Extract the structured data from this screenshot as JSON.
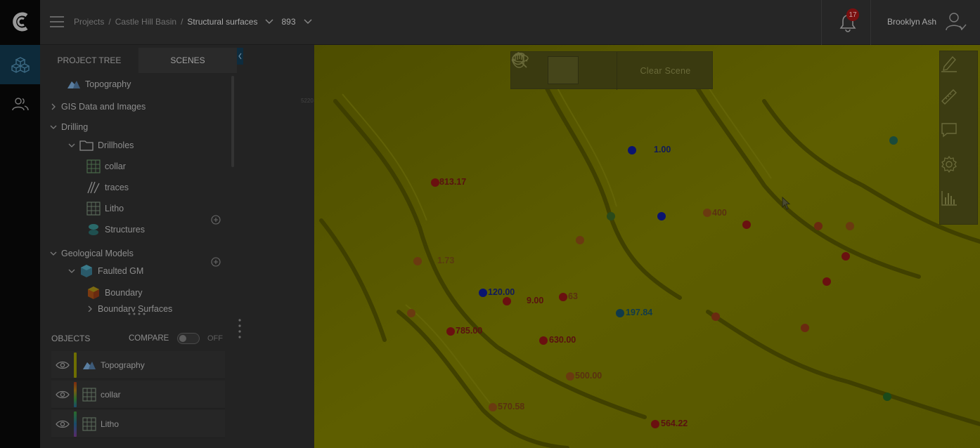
{
  "header": {
    "breadcrumb": {
      "projects": "Projects",
      "sep1": "/",
      "project": "Castle Hill Basin",
      "sep2": "/",
      "current": "Structural surfaces",
      "version": "893"
    },
    "notifications_count": "17",
    "user_name": "Brooklyn Ash"
  },
  "panel": {
    "tabs": [
      {
        "label": "PROJECT TREE",
        "active": false
      },
      {
        "label": "SCENES",
        "active": true
      }
    ],
    "tree": [
      {
        "label": "Topography",
        "icon": "topography-icon"
      },
      {
        "label": "GIS Data and Images",
        "icon": "caret-right-icon"
      },
      {
        "label": "Drilling",
        "icon": "caret-down-icon"
      },
      {
        "label": "Drillholes",
        "icon": "folder-icon"
      },
      {
        "label": "collar",
        "icon": "grid-table-icon"
      },
      {
        "label": "traces",
        "icon": "traces-icon"
      },
      {
        "label": "Litho",
        "icon": "grid-table-icon"
      },
      {
        "label": "Structures",
        "icon": "structures-icon"
      },
      {
        "label": "Geological Models",
        "icon": "caret-down-icon"
      },
      {
        "label": "Faulted GM",
        "icon": "cube-icon"
      },
      {
        "label": "Boundary",
        "icon": "boundary-icon"
      },
      {
        "label": "Boundary Surfaces",
        "icon": "caret-right-icon"
      }
    ],
    "objects": {
      "title": "OBJECTS",
      "compare_label": "COMPARE",
      "toggle_state": "OFF",
      "items": [
        {
          "label": "Topography",
          "color": "#6e6e00"
        },
        {
          "label": "collar",
          "color": "#7a2a10"
        },
        {
          "label": "Litho",
          "color": "#2a5a2a"
        }
      ]
    },
    "axis_tick": "5220"
  },
  "scene": {
    "toolbar": {
      "clear_label": "Clear Scene",
      "buttons": [
        "orbit-icon",
        "pan-hand-icon",
        "zoom-icon"
      ],
      "active": "pan-hand-icon"
    },
    "side_tools": [
      "edit-pencil-icon",
      "ruler-icon",
      "comment-icon",
      "gear-icon",
      "bar-chart-icon"
    ],
    "labels": [
      {
        "text": "1.00",
        "color": "#101a5a"
      },
      {
        "text": "813.17",
        "color": "#5a1010"
      },
      {
        "text": "400",
        "color": "#5a3010"
      },
      {
        "text": "1.73",
        "color": "#5a3a10"
      },
      {
        "text": "120.00",
        "color": "#101a5a"
      },
      {
        "text": "9.00",
        "color": "#5a1010"
      },
      {
        "text": "63",
        "color": "#5a3010"
      },
      {
        "text": "197.84",
        "color": "#103a4a"
      },
      {
        "text": "785.00",
        "color": "#5a1010"
      },
      {
        "text": "630.00",
        "color": "#5a1010"
      },
      {
        "text": "500.00",
        "color": "#5a3010"
      },
      {
        "text": "570.58",
        "color": "#5a3010"
      },
      {
        "text": "564.22",
        "color": "#5a1010"
      }
    ]
  },
  "colors": {
    "terrain": "#5c5c00",
    "accent": "#0d2a3a",
    "badge": "#7a1010"
  }
}
